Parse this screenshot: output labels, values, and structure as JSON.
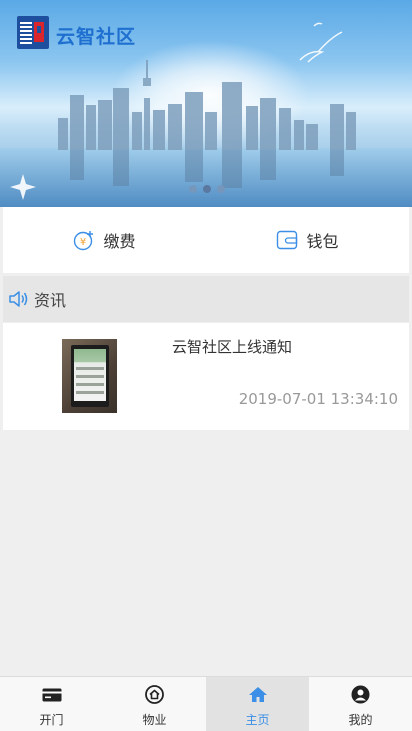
{
  "app": {
    "title": "云智社区"
  },
  "banner": {
    "pager_count": 3,
    "active_index": 1
  },
  "actions": [
    {
      "label": "缴费",
      "icon": "payment-icon"
    },
    {
      "label": "钱包",
      "icon": "wallet-icon"
    }
  ],
  "news": {
    "header": "资讯",
    "items": [
      {
        "title": "云智社区上线通知",
        "time": "2019-07-01 13:34:10"
      }
    ]
  },
  "tabbar": {
    "items": [
      {
        "label": "开门",
        "icon": "door-card-icon"
      },
      {
        "label": "物业",
        "icon": "property-home-icon"
      },
      {
        "label": "主页",
        "icon": "home-icon"
      },
      {
        "label": "我的",
        "icon": "user-icon"
      }
    ],
    "active_index": 2
  },
  "colors": {
    "accent": "#3b8fe6",
    "brand_blue": "#1f6fd0",
    "brand_red": "#d9252b"
  }
}
